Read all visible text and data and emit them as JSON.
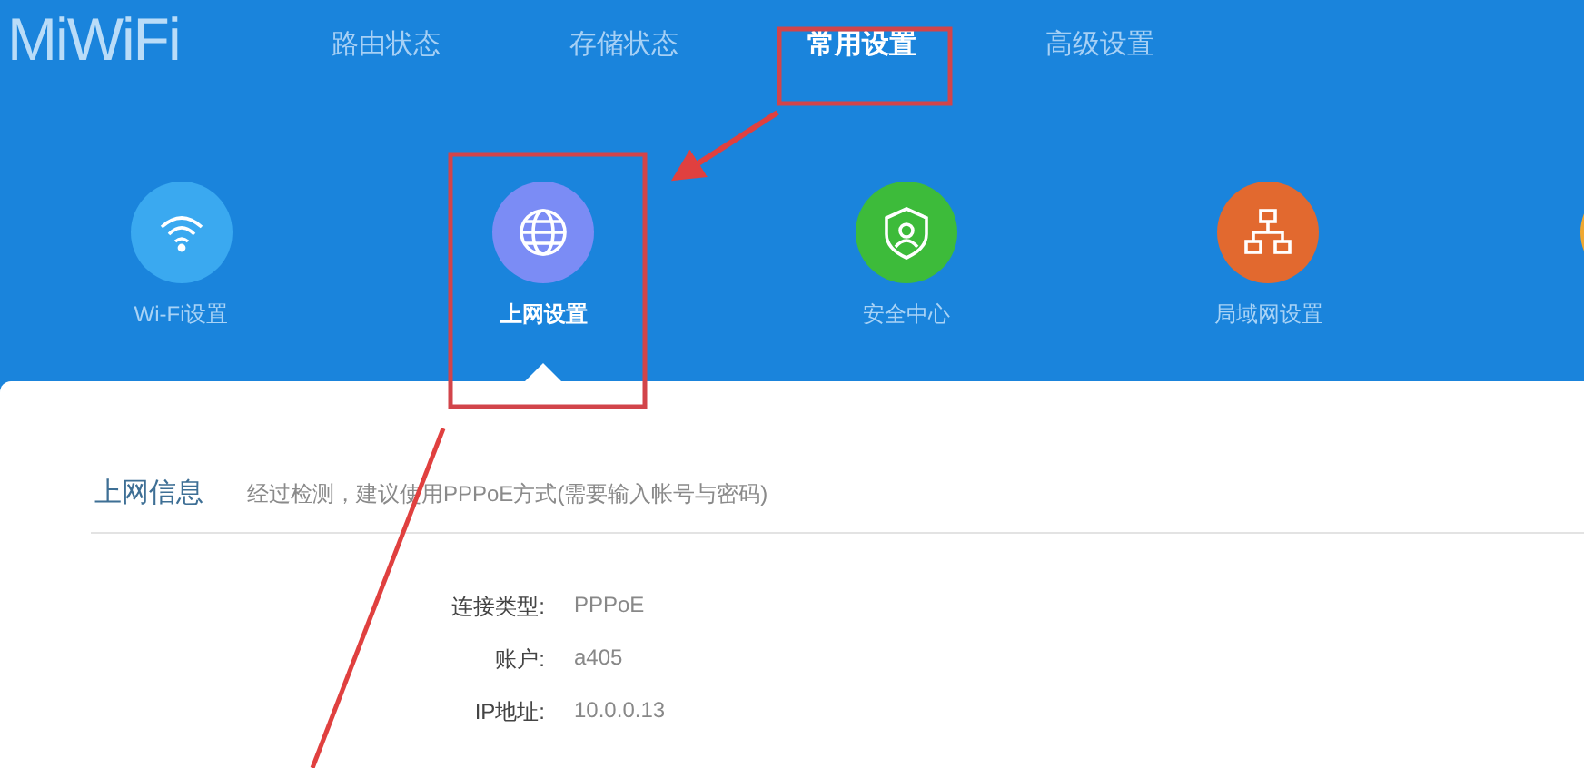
{
  "logo": "MiWiFi",
  "nav": [
    {
      "label": "路由状态",
      "selected": false
    },
    {
      "label": "存储状态",
      "selected": false
    },
    {
      "label": "常用设置",
      "selected": true
    },
    {
      "label": "高级设置",
      "selected": false
    }
  ],
  "shortcuts": [
    {
      "kind": "wifi",
      "label": "Wi-Fi设置",
      "color": "#3aa9f0",
      "selected": false
    },
    {
      "kind": "globe",
      "label": "上网设置",
      "color": "#7b8cf5",
      "selected": true
    },
    {
      "kind": "shield",
      "label": "安全中心",
      "color": "#3dbb3a",
      "selected": false
    },
    {
      "kind": "network",
      "label": "局域网设置",
      "color": "#e2692f",
      "selected": false
    },
    {
      "kind": "blank",
      "color": "#f0a830"
    }
  ],
  "section": {
    "title": "上网信息",
    "hint": "经过检测，建议使用PPPoE方式(需要输入帐号与密码)"
  },
  "info": [
    {
      "label": "连接类型:",
      "value": "PPPoE"
    },
    {
      "label": "账户:",
      "value": "a405"
    },
    {
      "label": "IP地址:",
      "value": "10.0.0.13"
    }
  ]
}
